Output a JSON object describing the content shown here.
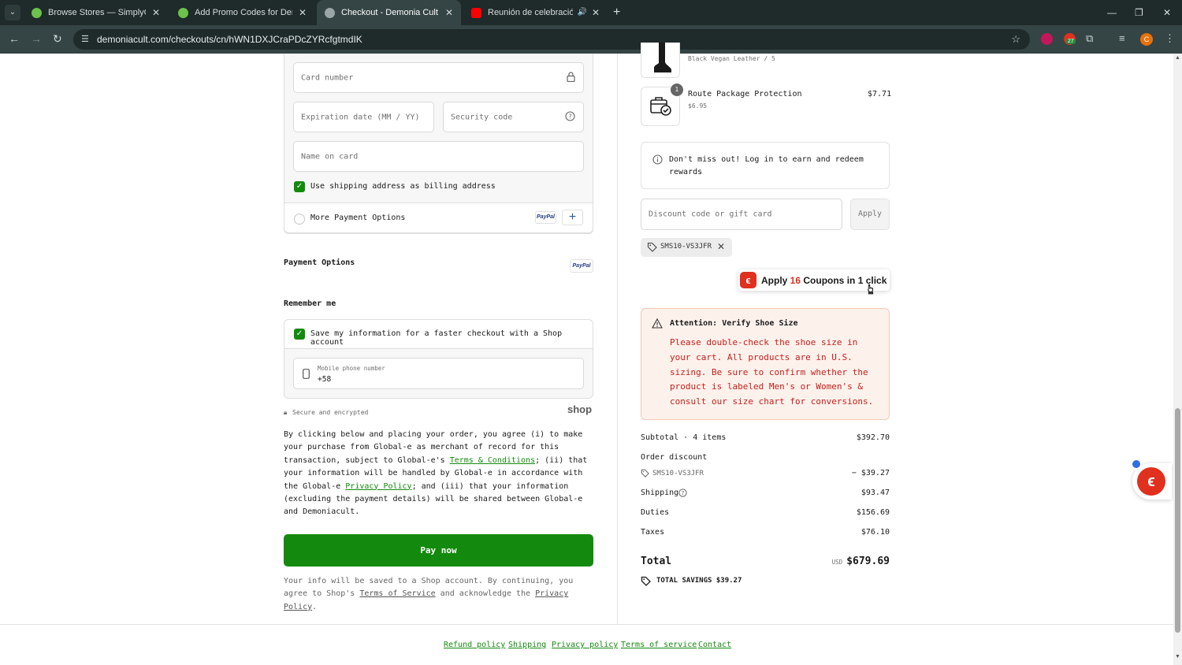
{
  "browser": {
    "tabs": [
      {
        "title": "Browse Stores — SimplyCodes",
        "favicon_color": "#6cc24a"
      },
      {
        "title": "Add Promo Codes for Demonia",
        "favicon_color": "#6cc24a"
      },
      {
        "title": "Checkout - Demonia Cult",
        "favicon_color": "#9aa6a6"
      },
      {
        "title": "Reunión de celebración | Ro",
        "favicon_color": "#ff0000"
      }
    ],
    "url": "demoniacult.com/checkouts/cn/hWN1DXJCraPDcZYRcfgtmdIK",
    "avatar_letter": "C",
    "ext_badge": "27"
  },
  "payment": {
    "card_number_placeholder": "Card number",
    "expiration_placeholder": "Expiration date (MM / YY)",
    "security_placeholder": "Security code",
    "name_placeholder": "Name on card",
    "billing_label": "Use shipping address as billing address",
    "more_options_label": "More Payment Options",
    "paypal_label": "PayPal",
    "payment_options_heading": "Payment Options"
  },
  "remember": {
    "heading": "Remember me",
    "save_label": "Save my information for a faster checkout with a Shop account",
    "phone_label": "Mobile phone number",
    "phone_value": "+58",
    "secure_label": "Secure and encrypted",
    "shop_logo": "shop"
  },
  "legal": {
    "p1": "By clicking below and placing your order, you agree (i) to make your purchase from Global-e as merchant of record for this transaction, subject to Global-e's ",
    "terms_link": "Terms & Conditions",
    "p2": "; (ii) that your information will be handled by Global-e in accordance with the Global-e ",
    "privacy_link": "Privacy Policy",
    "p3": "; and (iii) that your information (excluding the payment details) will be shared between Global-e and Demoniacult."
  },
  "pay_button": "Pay now",
  "note": {
    "p1": "Your info will be saved to a Shop account. By continuing, you agree to Shop's ",
    "tos_link": "Terms of Service",
    "p2": " and acknowledge the ",
    "privacy_link": "Privacy Policy",
    "p3": "."
  },
  "footer_links": [
    "Refund policy",
    "Shipping",
    "Privacy policy",
    "Terms of service",
    "Contact"
  ],
  "summary": {
    "item1_variant": "Black Vegan Leather / 5",
    "item2_name": "Route Package Protection",
    "item2_sub": "$6.95",
    "item2_price": "$7.71",
    "item2_qty": "1",
    "info_text": "Don't miss out! Log in to earn and redeem rewards",
    "discount_placeholder": "Discount code or gift card",
    "apply_label": "Apply",
    "chip_code": "SMS10-VS3JFR",
    "coupon_pre": "Apply ",
    "coupon_count": "16",
    "coupon_post": " Coupons in 1 click",
    "attention_title": "Attention: Verify Shoe Size",
    "attention_body": "Please double-check the shoe size in your cart. All products are in U.S. sizing. Be sure to confirm whether the product is labeled Men's or Women's & consult our size chart for conversions.",
    "subtotal_label": "Subtotal · 4 items",
    "subtotal_value": "$392.70",
    "order_discount_label": "Order discount",
    "discount_code": "SMS10-VS3JFR",
    "discount_value": "− $39.27",
    "shipping_label": "Shipping",
    "shipping_value": "$93.47",
    "duties_label": "Duties",
    "duties_value": "$156.69",
    "taxes_label": "Taxes",
    "taxes_value": "$76.10",
    "total_label": "Total",
    "currency": "USD",
    "total_value": "$679.69",
    "savings_label": "TOTAL SAVINGS $39.27"
  }
}
